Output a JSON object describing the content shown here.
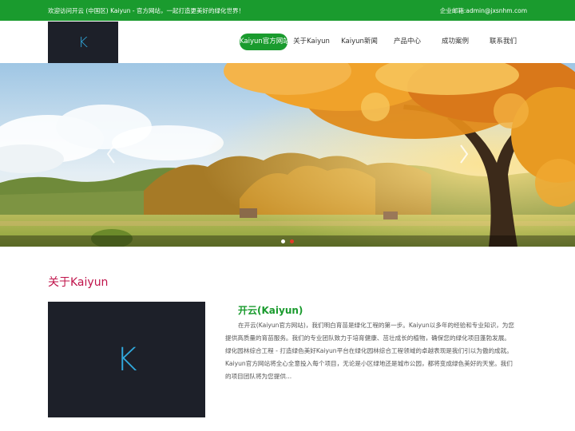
{
  "topbar": {
    "welcome": "欢迎访问开云 (中国区) Kaiyun - 官方网站，一起打造更美好的绿化世界！",
    "email": "企业邮箱:admin@jxsnhm.com"
  },
  "logo": {
    "letter": "K"
  },
  "nav": {
    "items": [
      {
        "label": "Kaiyun官方网站",
        "active": true
      },
      {
        "label": "关于Kaiyun",
        "active": false
      },
      {
        "label": "Kaiyun新闻",
        "active": false
      },
      {
        "label": "产品中心",
        "active": false
      },
      {
        "label": "成功案例",
        "active": false
      },
      {
        "label": "联系我们",
        "active": false
      }
    ]
  },
  "banner": {
    "prev_icon": "chevron-left-icon",
    "next_icon": "chevron-right-icon",
    "slide_count": 2,
    "active_slide": 1
  },
  "about": {
    "section_title": "关于Kaiyun",
    "image_letter": "K",
    "heading": "开云(Kaiyun)",
    "body": "在开云(Kaiyun官方网站)，我们明白育苗是绿化工程的第一步。Kaiyun以多年的经验和专业知识，为您提供高质量的育苗服务。我们的专业团队致力于培育健康、茁壮成长的植物，确保您的绿化项目蓬勃发展。绿化园林综合工程 - 打造绿色美好Kaiyun平台在绿化园林综合工程领域的卓越表现是我们引以为傲的成就。Kaiyun官方网站将全心全意投入每个项目，无论是小区绿地还是城市公园，都将变成绿色美好的天堂。我们的项目团队将为您提供..."
  },
  "colors": {
    "brand_green": "#1a9b2e",
    "title_red": "#c0144b",
    "logo_bg": "#1d2029",
    "logo_accent": "#31a9dd"
  }
}
